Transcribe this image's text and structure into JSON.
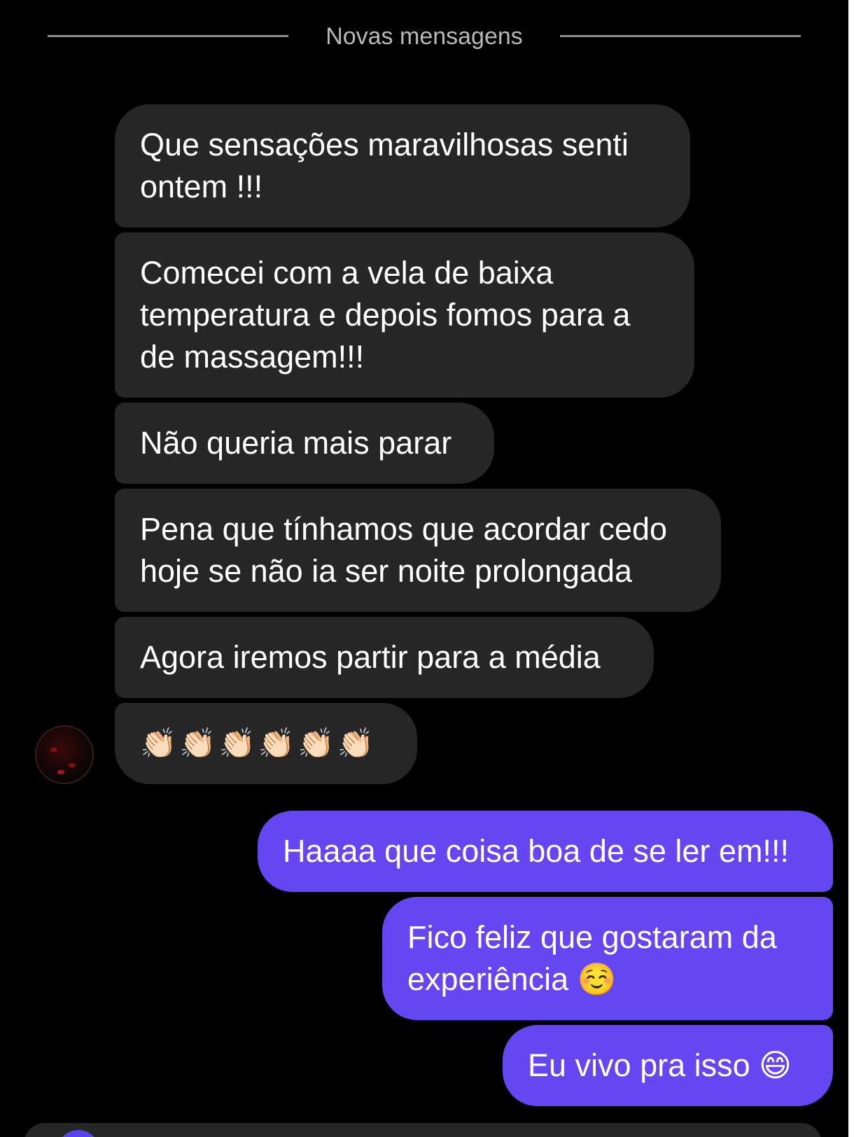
{
  "divider": {
    "label": "Novas mensagens"
  },
  "messages_in": [
    {
      "text": "Que sensações maravilhosas senti\nontem !!!"
    },
    {
      "text": "Comecei com a vela de baixa\ntemperatura e depois fomos para a\nde massagem!!!"
    },
    {
      "text": "Não queria mais parar"
    },
    {
      "text": "Pena que tínhamos que acordar cedo\nhoje se não ia ser noite prolongada"
    },
    {
      "text": "Agora iremos partir para a média"
    },
    {
      "text": "👏🏻👏🏻👏🏻👏🏻👏🏻👏🏻"
    }
  ],
  "messages_out": [
    {
      "text": "Haaaa que coisa boa de se ler em!!!"
    },
    {
      "text": "Fico feliz que gostaram da\nexperiência ☺️"
    },
    {
      "text": "Eu vivo pra isso 😄"
    }
  ],
  "colors": {
    "incoming_bubble": "#262626",
    "outgoing_bubble": "#6547f1",
    "background": "#000000"
  },
  "icons": {
    "avatar": "contact-avatar",
    "composer_camera": "camera-icon"
  }
}
